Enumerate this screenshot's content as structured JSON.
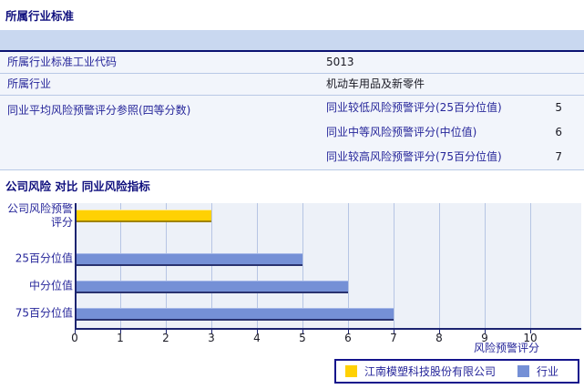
{
  "section1": {
    "title": "所属行业标准",
    "rows": [
      {
        "label": "所属行业标准工业代码",
        "value": "5013"
      },
      {
        "label": "所属行业",
        "value": "机动车用品及新零件"
      }
    ],
    "group_row": {
      "label": "同业平均风险预警评分参照(四等分数)",
      "items": [
        {
          "label": "同业较低风险预警评分(25百分位值)",
          "value": "5"
        },
        {
          "label": "同业中等风险预警评分(中位值)",
          "value": "6"
        },
        {
          "label": "同业较高风险预警评分(75百分位值)",
          "value": "7"
        }
      ]
    }
  },
  "section2": {
    "title": "公司风险 对比 同业风险指标"
  },
  "chart_data": {
    "type": "bar",
    "orientation": "horizontal",
    "title": "公司风险 对比 同业风险指标",
    "categories": [
      "公司风险预警评分",
      "25百分位值",
      "中分位值",
      "75百分位值"
    ],
    "series": [
      {
        "name": "江南模塑科技股份有限公司",
        "color": "#ffd103",
        "values": [
          3,
          null,
          null,
          null
        ]
      },
      {
        "name": "行业",
        "color": "#7590d6",
        "values": [
          null,
          5,
          6,
          7
        ]
      }
    ],
    "xlabel": "风险预警评分",
    "xlim": [
      0,
      10
    ],
    "xticks": [
      0,
      1,
      2,
      3,
      4,
      5,
      6,
      7,
      8,
      9,
      10
    ],
    "grid": true,
    "legend_position": "bottom-right",
    "plot_bg": "#edf1f8",
    "gridline_color": "#b6c5e4",
    "axis_color": "#1c2470"
  }
}
